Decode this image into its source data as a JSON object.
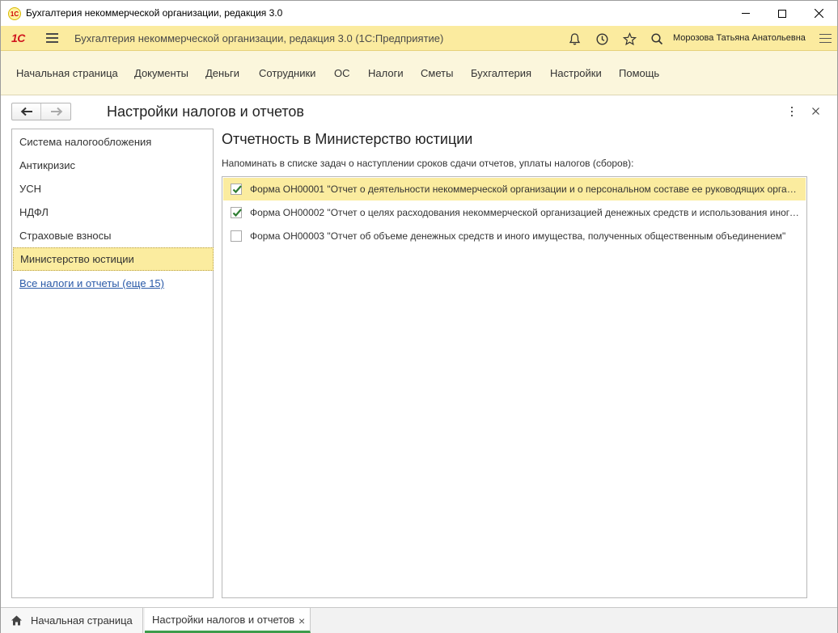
{
  "window": {
    "title": "Бухгалтерия некоммерческой организации, редакция 3.0"
  },
  "header": {
    "logo": "1С",
    "app_title": "Бухгалтерия некоммерческой организации, редакция 3.0  (1С:Предприятие)",
    "user": "Морозова Татьяна Анатольевна",
    "icons": [
      "bell-icon",
      "history-icon",
      "star-icon",
      "search-icon",
      "menu-icon"
    ]
  },
  "sections": [
    "Начальная страница",
    "Документы",
    "Деньги",
    "Сотрудники",
    "ОС",
    "Налоги",
    "Сметы",
    "Бухгалтерия",
    "Настройки",
    "Помощь"
  ],
  "form": {
    "title": "Настройки налогов и отчетов"
  },
  "nav": {
    "items": [
      "Система налогообложения",
      "Антикризис",
      "УСН",
      "НДФЛ",
      "Страховые взносы",
      "Министерство юстиции"
    ],
    "active_index": 5,
    "link": "Все налоги и отчеты (еще 15)"
  },
  "content": {
    "section_title": "Отчетность в Министерство юстиции",
    "hint": "Напоминать в списке задач о наступлении сроков сдачи отчетов, уплаты налогов (сборов):",
    "rows": [
      {
        "label": "Форма ОН00001 \"Отчет о деятельности некоммерческой организации и о персональном составе ее руководящих органов\"",
        "checked": true
      },
      {
        "label": "Форма ОН00002 \"Отчет о целях расходования некоммерческой организацией денежных средств и использования иного имущества\"",
        "checked": true
      },
      {
        "label": "Форма ОН00003 \"Отчет об объеме денежных средств и иного имущества, полученных общественным объединением\"",
        "checked": false
      }
    ]
  },
  "taskbar": {
    "home": "Начальная страница",
    "current": "Настройки налогов и отчетов",
    "close": "×"
  },
  "colors": {
    "header_bg": "#fbeb9f",
    "sections_bg": "#fbf6dc",
    "selected_bg": "#fbec9f",
    "checkmark": "#2e7d32",
    "link": "#2a5aa8",
    "logo_red": "#d0161e"
  }
}
